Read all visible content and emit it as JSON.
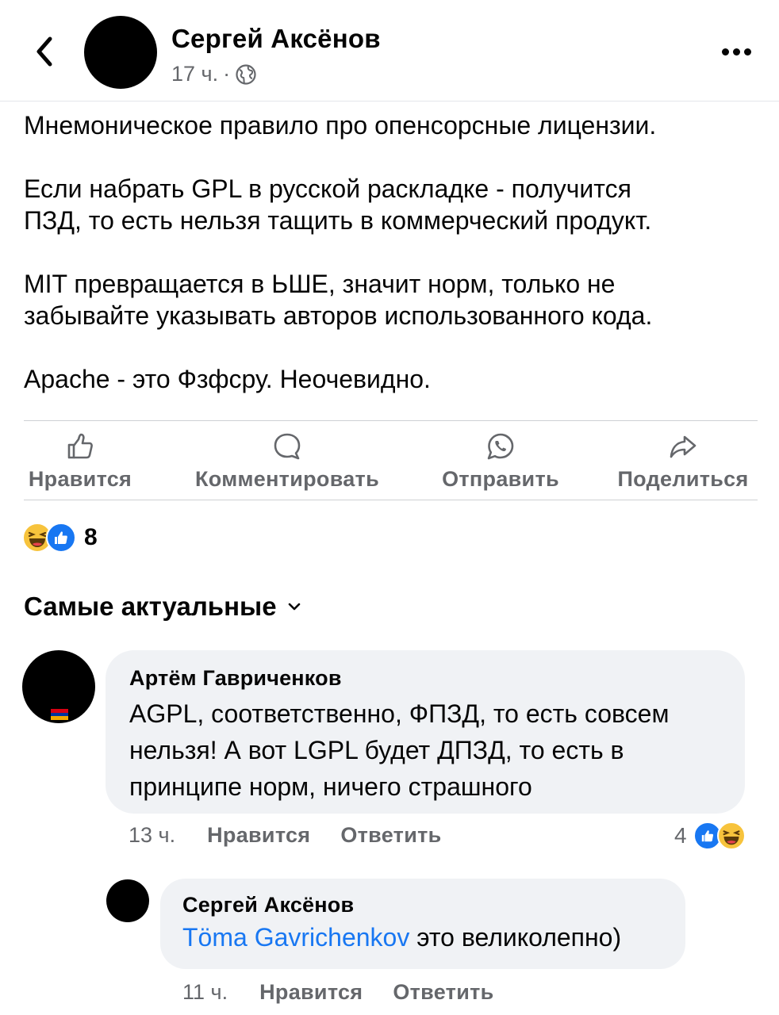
{
  "header": {
    "author": "Сергей Аксёнов",
    "time": "17 ч.",
    "separator": "·"
  },
  "post": {
    "paragraphs": [
      "Мнемоническое правило про опенсорсные лицензии.",
      "Если набрать GPL в русской раскладке - получится\nПЗД, то есть нельзя тащить в коммерческий продукт.",
      "MIT превращается в ЬШЕ, значит норм, только не\nзабывайте указывать авторов использованного кода.",
      "Apache - это Фзфсру. Неочевидно."
    ]
  },
  "actions": {
    "like": "Нравится",
    "comment": "Комментировать",
    "send": "Отправить",
    "share": "Поделиться"
  },
  "reactions": {
    "count": "8",
    "icons": [
      "haha-icon",
      "like-icon"
    ]
  },
  "comments_sort": {
    "label": "Самые актуальные"
  },
  "comments": [
    {
      "author": "Артём Гавриченков",
      "text": "AGPL, соответственно, ФПЗД, то есть совсем нельзя! А вот LGPL будет ДПЗД, то есть в принципе норм, ничего страшного",
      "time": "13 ч.",
      "like": "Нравится",
      "reply": "Ответить",
      "reaction_count": "4"
    },
    {
      "author": "Сергей Аксёнов",
      "mention": "Töma Gavrichenkov",
      "text": " это великолепно)",
      "time": "11 ч.",
      "like": "Нравится",
      "reply": "Ответить"
    }
  ],
  "colors": {
    "link": "#1877f2",
    "secondary_text": "#65676b",
    "bubble": "#f0f2f5",
    "haha": "#f7c33c",
    "like": "#1877f2"
  }
}
